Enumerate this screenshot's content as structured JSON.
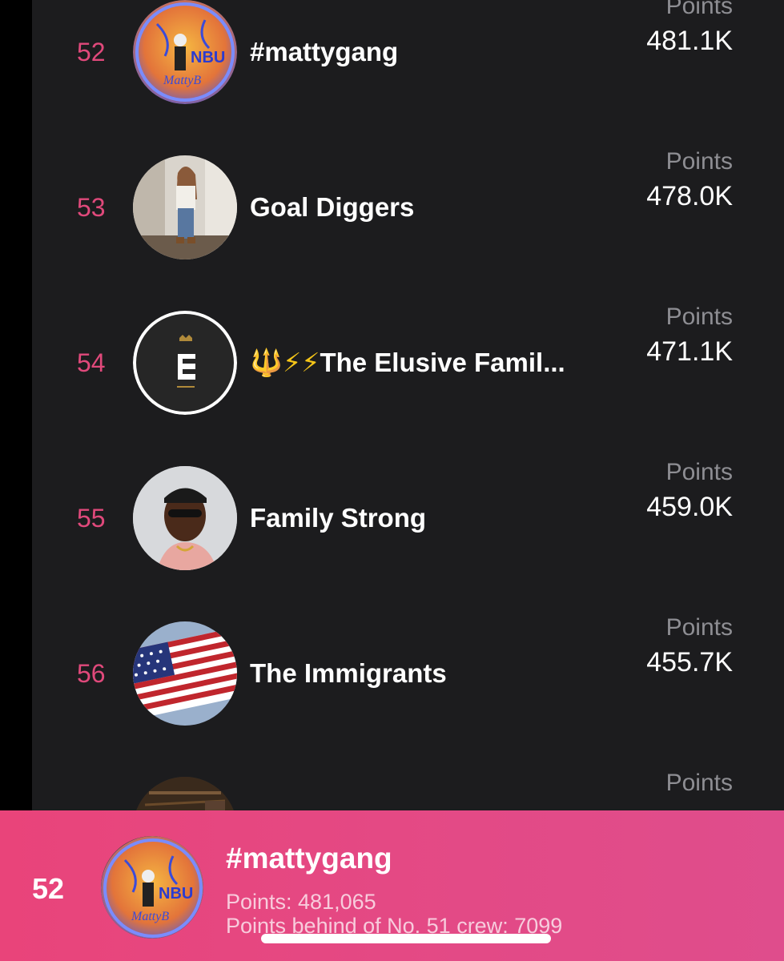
{
  "leaderboard": {
    "rows": [
      {
        "rank": "52",
        "name": "#mattygang",
        "points_label": "Points",
        "points": "481.1K",
        "avatar": "nbu-logo-avatar"
      },
      {
        "rank": "53",
        "name": "Goal Diggers",
        "points_label": "Points",
        "points": "478.0K",
        "avatar": "woman-selfie-avatar"
      },
      {
        "rank": "54",
        "name": "The Elusive Famil...",
        "name_prefix": "🔱⚡⚡",
        "points_label": "Points",
        "points": "471.1K",
        "avatar": "elusive-e-logo-avatar"
      },
      {
        "rank": "55",
        "name": "Family Strong",
        "points_label": "Points",
        "points": "459.0K",
        "avatar": "man-sunglasses-avatar"
      },
      {
        "rank": "56",
        "name": "The Immigrants",
        "points_label": "Points",
        "points": "455.7K",
        "avatar": "american-flag-avatar"
      },
      {
        "rank": "",
        "name": "",
        "points_label": "Points",
        "points": "",
        "avatar": "partial-avatar"
      }
    ]
  },
  "my_crew": {
    "rank": "52",
    "name": "#mattygang",
    "points_text": "Points: 481,065",
    "behind_text": "Points behind of No. 51 crew: 7099",
    "avatar": "nbu-logo-avatar"
  },
  "colors": {
    "rank": "#e0497b",
    "footer_gradient_start": "#e9447a",
    "footer_gradient_end": "#df4d8c",
    "panel_bg": "#1c1c1e"
  }
}
